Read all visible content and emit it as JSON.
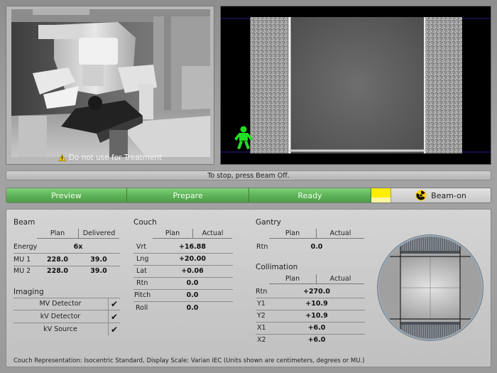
{
  "camera": {
    "warning_text": "Do not use for Treatment",
    "warning_icon": "warning-triangle-icon"
  },
  "imager": {
    "marker_icon": "patient-figure-icon",
    "marker_color": "#22dd22"
  },
  "status": {
    "message": "To stop, press Beam Off."
  },
  "workflow": {
    "steps": [
      {
        "label": "Preview"
      },
      {
        "label": "Prepare"
      },
      {
        "label": "Ready"
      }
    ],
    "active_color": "#5db358",
    "indicator_color": "#ffee00",
    "beam_label": "Beam-on",
    "beam_icon": "radiation-icon"
  },
  "beam": {
    "title": "Beam",
    "col_plan": "Plan",
    "col_delivered": "Delivered",
    "rows": [
      {
        "label": "Energy",
        "value": "6x"
      },
      {
        "label": "MU 1",
        "plan": "228.0",
        "delivered": "39.0"
      },
      {
        "label": "MU 2",
        "plan": "228.0",
        "delivered": "39.0"
      }
    ]
  },
  "imaging": {
    "title": "Imaging",
    "rows": [
      {
        "label": "MV Detector",
        "check": "✔"
      },
      {
        "label": "kV Detector",
        "check": "✔"
      },
      {
        "label": "kV Source",
        "check": "✔"
      }
    ]
  },
  "couch": {
    "title": "Couch",
    "col_plan": "Plan",
    "col_actual": "Actual",
    "rows": [
      {
        "label": "Vrt",
        "value": "+16.88"
      },
      {
        "label": "Lng",
        "value": "+20.00"
      },
      {
        "label": "Lat",
        "value": "+0.06"
      },
      {
        "label": "Rtn",
        "value": "0.0"
      },
      {
        "label": "Pitch",
        "value": "0.0"
      },
      {
        "label": "Roll",
        "value": "0.0"
      }
    ]
  },
  "gantry": {
    "title": "Gantry",
    "col_plan": "Plan",
    "col_actual": "Actual",
    "rows": [
      {
        "label": "Rtn",
        "value": "0.0"
      }
    ]
  },
  "collimation": {
    "title": "Collimation",
    "col_plan": "Plan",
    "col_actual": "Actual",
    "rows": [
      {
        "label": "Rtn",
        "value": "+270.0"
      },
      {
        "label": "Y1",
        "value": "+10.9"
      },
      {
        "label": "Y2",
        "value": "+10.9"
      },
      {
        "label": "X1",
        "value": "+6.0"
      },
      {
        "label": "X2",
        "value": "+6.0"
      }
    ]
  },
  "footer": {
    "note": "Couch Representation: Isocentric Standard, Display Scale: Varian IEC (Units shown are centimeters, degrees or MU.)"
  }
}
